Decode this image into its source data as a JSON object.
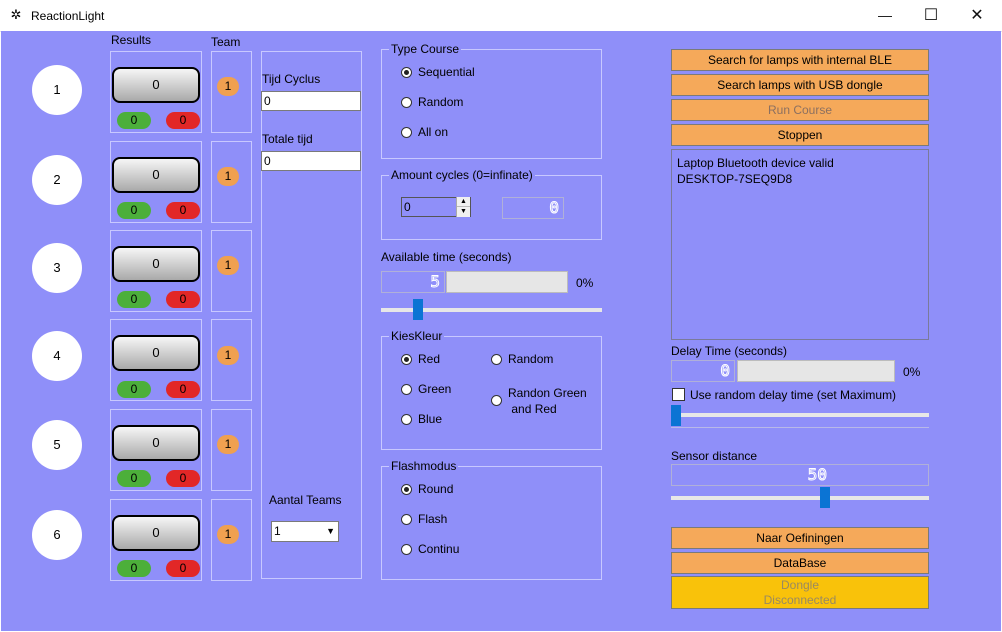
{
  "window": {
    "title": "ReactionLight",
    "minimize": "—",
    "maximize": "☐",
    "close": "✕"
  },
  "headers": {
    "results": "Results",
    "team": "Team"
  },
  "lanes": [
    {
      "number": "1",
      "score": "0",
      "green": "0",
      "red": "0",
      "team": "1"
    },
    {
      "number": "2",
      "score": "0",
      "green": "0",
      "red": "0",
      "team": "1"
    },
    {
      "number": "3",
      "score": "0",
      "green": "0",
      "red": "0",
      "team": "1"
    },
    {
      "number": "4",
      "score": "0",
      "green": "0",
      "red": "0",
      "team": "1"
    },
    {
      "number": "5",
      "score": "0",
      "green": "0",
      "red": "0",
      "team": "1"
    },
    {
      "number": "6",
      "score": "0",
      "green": "0",
      "red": "0",
      "team": "1"
    }
  ],
  "timing": {
    "cycle_label": "Tijd Cyclus",
    "cycle_value": "0",
    "total_label": "Totale tijd",
    "total_value": "0",
    "teams_label": "Aantal Teams",
    "teams_value": "1"
  },
  "course": {
    "title": "Type Course",
    "options": [
      "Sequential",
      "Random",
      "All on"
    ],
    "selected": "Sequential"
  },
  "cycles": {
    "title": "Amount cycles (0=infinate)",
    "value": "0",
    "display": "0"
  },
  "available": {
    "title": "Available time (seconds)",
    "display": "5",
    "percent": "0%",
    "slider_fraction": 0.15
  },
  "color": {
    "title": "KiesKleur",
    "options": [
      "Red",
      "Green",
      "Blue",
      "Random",
      "Randon Green",
      "and Red"
    ],
    "selected": "Red"
  },
  "flash": {
    "title": "Flashmodus",
    "options": [
      "Round",
      "Flash",
      "Continu"
    ],
    "selected": "Round"
  },
  "buttons": {
    "ble": "Search for lamps with internal BLE",
    "usb": "Search lamps with USB dongle",
    "run": "Run Course",
    "stop": "Stoppen",
    "exercises": "Naar Oefiningen",
    "database": "DataBase",
    "dongle_1": "Dongle",
    "dongle_2": "Disconnected"
  },
  "log": [
    "Laptop Bluetooth device valid",
    "DESKTOP-7SEQ9D8"
  ],
  "delay": {
    "title": "Delay Time (seconds)",
    "display": "0",
    "percent": "0%",
    "random_label": "Use random delay time (set Maximum)",
    "slider_fraction": 0.0
  },
  "sensor": {
    "title": "Sensor distance",
    "display": "50",
    "slider_fraction": 0.6
  },
  "colors": {
    "background": "#8f8ff9",
    "orange": "#f5a95a",
    "dongle": "#f9c20a",
    "slider": "#0b74d4"
  }
}
